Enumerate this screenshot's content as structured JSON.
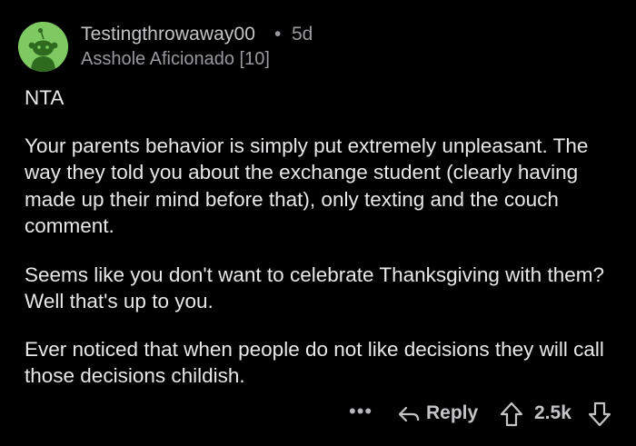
{
  "comment": {
    "username": "Testingthrowaway00",
    "separator": "•",
    "age": "5d",
    "flair": "Asshole Aficionado [10]",
    "paragraphs": [
      "NTA",
      "Your parents behavior is simply put extremely unpleasant. The way they told you about the exchange student (clearly having made up their mind before that), only texting and the couch comment.",
      "Seems like you don't want to celebrate Thanksgiving with them? Well that's up to you.",
      "Ever noticed that when people do not like decisions they will call those decisions childish."
    ],
    "more_label": "•••",
    "reply_label": "Reply",
    "score": "2.5k",
    "icons": {
      "avatar": "snoo-avatar-icon",
      "reply": "reply-arrow-icon",
      "upvote": "upvote-arrow-icon",
      "downvote": "downvote-arrow-icon",
      "more": "more-options-icon"
    },
    "colors": {
      "background": "#000000",
      "avatar_bg": "#7ec962",
      "text": "#e8e8ea",
      "meta": "#9a9a9e"
    }
  }
}
